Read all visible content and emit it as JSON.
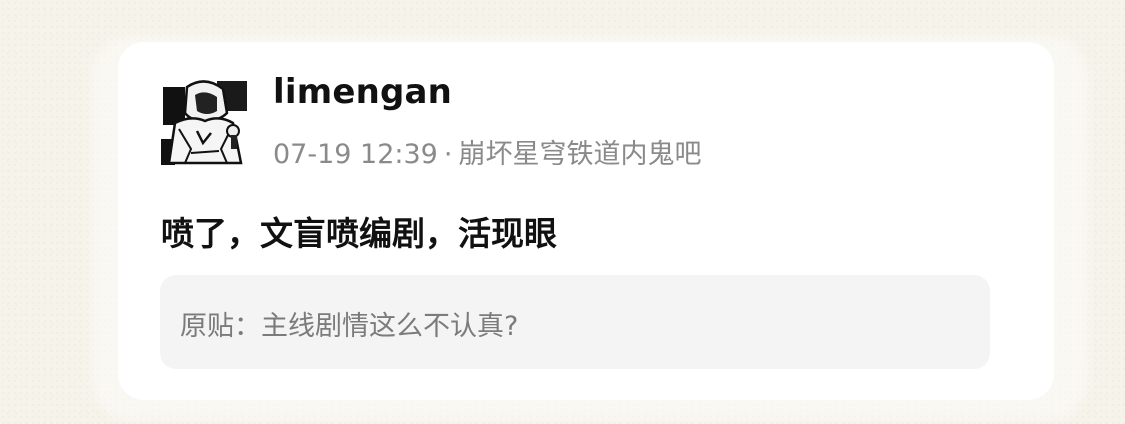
{
  "post": {
    "username": "limengan",
    "timestamp": "07-19 12:39",
    "separator": "·",
    "forum": "崩坏星穹铁道内鬼吧",
    "content": "喷了，文盲喷编剧，活现眼",
    "quote": {
      "prefix": "原贴：",
      "title": "主线剧情这么不认真?"
    },
    "avatar_icon": "hooded-figure-avatar"
  }
}
